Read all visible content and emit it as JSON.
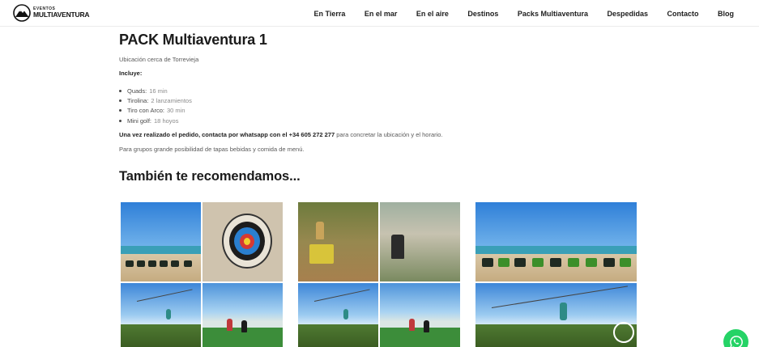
{
  "header": {
    "logo_small": "EVENTOS",
    "logo_big": "MULTIAVENTURA",
    "nav": [
      "En Tierra",
      "En el mar",
      "En el aire",
      "Destinos",
      "Packs Multiaventura",
      "Despedidas",
      "Contacto",
      "Blog"
    ]
  },
  "main": {
    "title": "PACK Multiaventura 1",
    "location": "Ubicación cerca de Torrevieja",
    "includes_label": "Incluye:",
    "items": [
      {
        "label": "Quads:",
        "value": "16 min"
      },
      {
        "label": "Tirolina:",
        "value": "2 lanzamientos"
      },
      {
        "label": "Tiro con Arco:",
        "value": "30 min"
      },
      {
        "label": "Mini golf:",
        "value": "18 hoyos"
      }
    ],
    "whatsapp_bold": "Una vez realizado el pedido, contacta por whatsapp con el +34 605 272 277",
    "whatsapp_rest": " para concretar la ubicación y el horario.",
    "groups_text": "Para grupos grande posibilidad de tapas bebidas y comida de menú.",
    "recommend_title": "También te recomendamos..."
  },
  "colors": {
    "accent_whatsapp": "#25d366",
    "text_dark": "#1b1b1b",
    "text_muted": "#5a5a5a"
  },
  "icons": {
    "logo": "mountain-logo-icon",
    "whatsapp": "whatsapp-icon"
  }
}
